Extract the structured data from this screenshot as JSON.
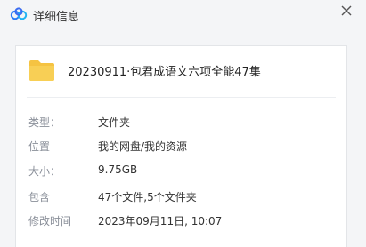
{
  "window": {
    "title": "详细信息",
    "app_icon": "baidu-netdisk-cloud-icon",
    "close_icon": "close-icon"
  },
  "file": {
    "icon": "folder-icon",
    "name": "20230911·包君成语文六项全能47集"
  },
  "properties": [
    {
      "label": "类型：",
      "value": "文件夹"
    },
    {
      "label": "位置",
      "value": "我的网盘/我的资源"
    },
    {
      "label": "大小：",
      "value": "9.75GB"
    },
    {
      "label": "包含",
      "value": "47个文件,5个文件夹"
    },
    {
      "label": "修改时间",
      "value": "2023年09月11日, 10:07"
    }
  ],
  "colors": {
    "folder": "#f5c342",
    "background": "#f4f5f7",
    "label": "#8a8f99"
  }
}
